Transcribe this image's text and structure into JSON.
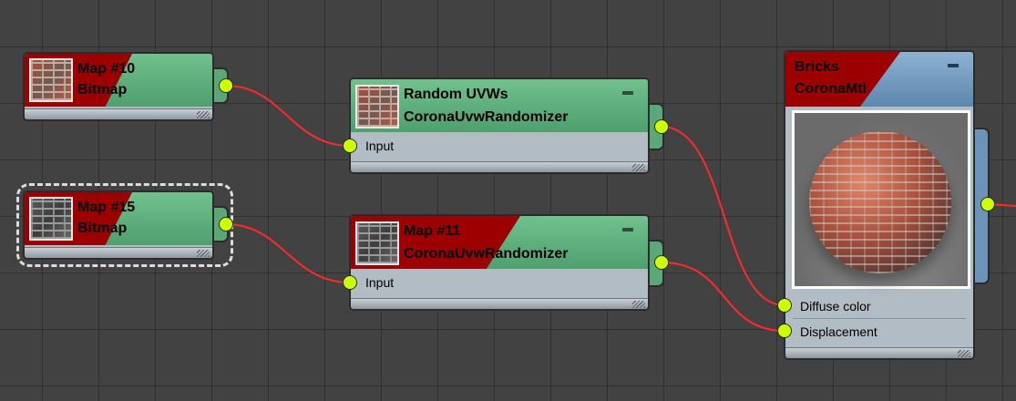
{
  "nodes": {
    "map10": {
      "name": "Map #10",
      "type": "Bitmap",
      "thumb": "brick-texture"
    },
    "map15": {
      "name": "Map #15",
      "type": "Bitmap",
      "thumb": "gray-brick-texture",
      "selected": true
    },
    "random_uvws": {
      "name": "Random UVWs",
      "type": "CoronaUvwRandomizer",
      "inputs": [
        "Input"
      ],
      "thumb": "brick-texture"
    },
    "map11": {
      "name": "Map #11",
      "type": "CoronaUvwRandomizer",
      "inputs": [
        "Input"
      ],
      "thumb": "gray-brick-texture"
    },
    "bricks": {
      "name": "Bricks",
      "type": "CoronaMtl",
      "inputs": [
        "Diffuse color",
        "Displacement"
      ],
      "preview": "brick-sphere"
    }
  },
  "colors": {
    "canvas": "#424242",
    "map_header": "#5fae7c",
    "material_header": "#7aa3c7",
    "flag": "#9c0000",
    "socket": "#ccff00",
    "wire": "#ff2a2a"
  },
  "icons": [
    "minimize-icon",
    "resize-grip-icon",
    "socket-dot"
  ]
}
